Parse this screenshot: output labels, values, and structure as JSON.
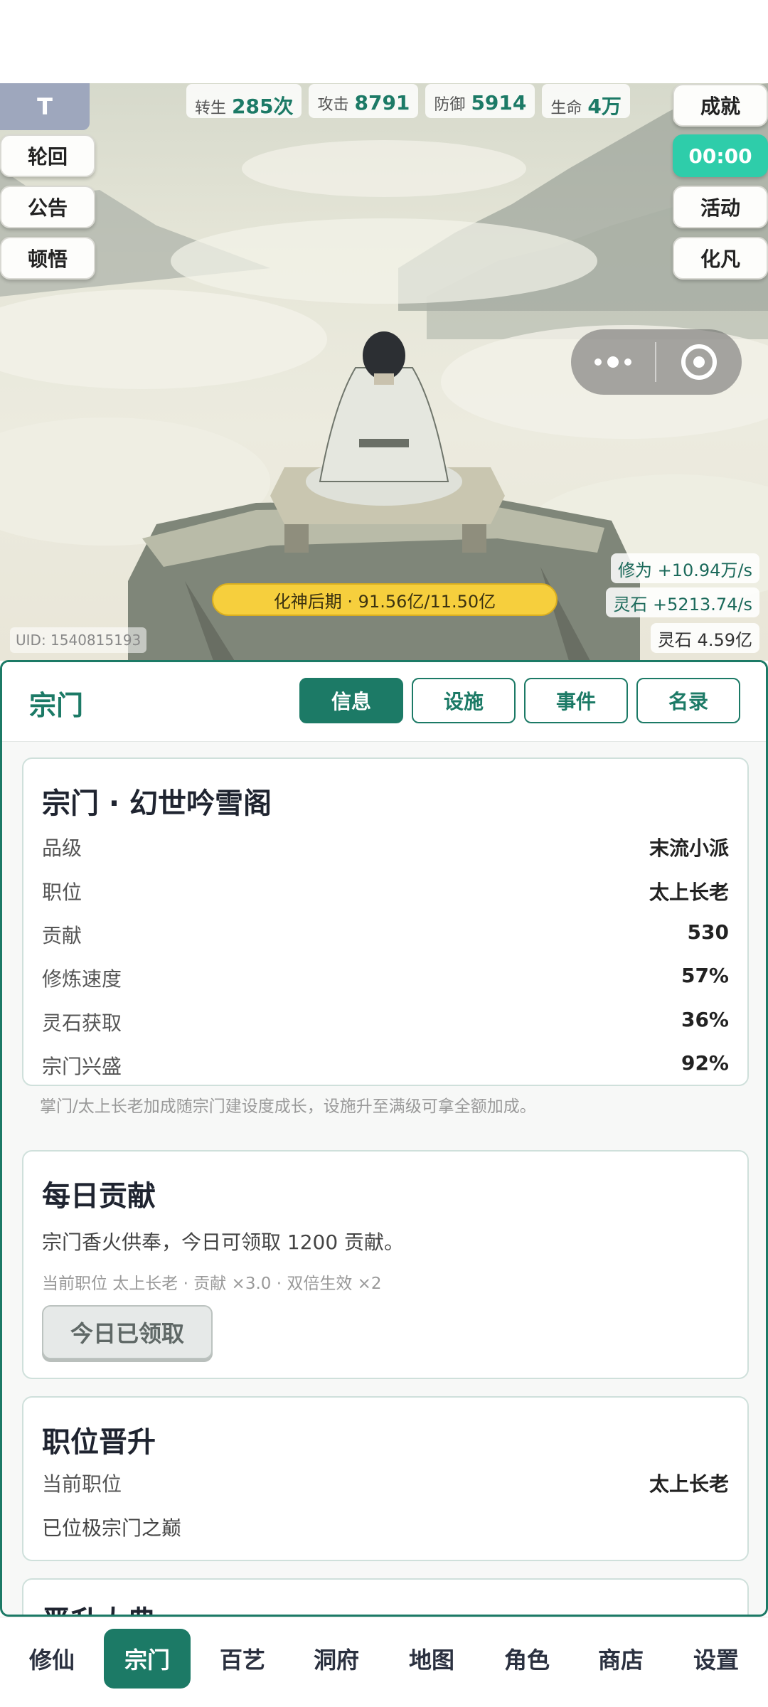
{
  "stats": [
    {
      "label": "转生",
      "value": "285次"
    },
    {
      "label": "攻击",
      "value": "8791"
    },
    {
      "label": "防御",
      "value": "5914"
    },
    {
      "label": "生命",
      "value": "4万"
    }
  ],
  "left_buttons": {
    "t": "T",
    "reincarnation": "轮回",
    "announcement": "公告",
    "enlightenment": "顿悟"
  },
  "right_buttons": {
    "achievement": "成就",
    "timer": "00:00",
    "activity": "活动",
    "mortal": "化凡"
  },
  "realm_progress": {
    "text": "化神后期 · 91.56亿/11.50亿"
  },
  "rates": {
    "cultivation": "修为 +10.94万/s",
    "spirit_stone_rate": "灵石 +5213.74/s",
    "spirit_stone_total": "灵石 4.59亿"
  },
  "uid": "UID: 1540815193",
  "panel": {
    "title": "宗门",
    "tabs": [
      "信息",
      "设施",
      "事件",
      "名录"
    ],
    "active_tab": "信息"
  },
  "sect_info": {
    "title": "宗门 · 幻世吟雪阁",
    "rows": [
      {
        "key": "品级",
        "value": "末流小派"
      },
      {
        "key": "职位",
        "value": "太上长老"
      },
      {
        "key": "贡献",
        "value": "530"
      },
      {
        "key": "修炼速度",
        "value": "57%"
      },
      {
        "key": "灵石获取",
        "value": "36%"
      },
      {
        "key": "宗门兴盛",
        "value": "92%"
      }
    ],
    "note": "掌门/太上长老加成随宗门建设度成长，设施升至满级可拿全额加成。"
  },
  "daily": {
    "title": "每日贡献",
    "desc": "宗门香火供奉，今日可领取 1200 贡献。",
    "note": "当前职位 太上长老 · 贡献 ×3.0 · 双倍生效 ×2",
    "button": "今日已领取"
  },
  "promotion": {
    "title": "职位晋升",
    "current_label": "当前职位",
    "current_value": "太上长老",
    "status": "已位极宗门之巅"
  },
  "peek": {
    "title": "晋升大典"
  },
  "bottom_nav": [
    "修仙",
    "宗门",
    "百艺",
    "洞府",
    "地图",
    "角色",
    "商店",
    "设置"
  ],
  "bottom_nav_active": "宗门"
}
